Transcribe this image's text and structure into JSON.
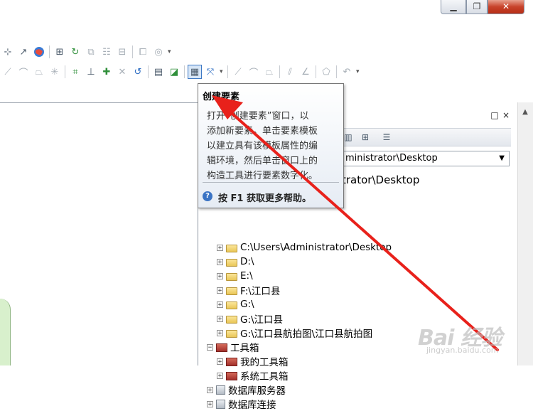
{
  "window": {
    "buttons": {
      "minimize": "▁",
      "maximize": "❐",
      "close": "✕"
    }
  },
  "tooltip": {
    "title": "创建要素",
    "body": "打开“创建要素”窗口，以添加新要素。单击要素模板以建立具有该模板属性的编辑环境，然后单击窗口上的构造工具进行要素数字化。",
    "body_lines": [
      "打开“创建要素”窗口，以",
      "添加新要素。单击要素模板",
      "以建立具有该模板属性的编",
      "辑环境，然后单击窗口上的",
      "构造工具进行要素数字化。"
    ],
    "help": "按 F1 获取更多帮助。",
    "help_icon": "?"
  },
  "catalog": {
    "path_value": "C:\\Users\\Administrator\\Desktop",
    "path_visible": "ministrator\\Desktop",
    "home_partial": "trator\\Desktop",
    "tree": [
      {
        "label": "C:\\Users\\Administrator\\Desktop",
        "icon": "folder",
        "expander": "+"
      },
      {
        "label": "D:\\",
        "icon": "folder",
        "expander": "+"
      },
      {
        "label": "E:\\",
        "icon": "folder",
        "expander": "+"
      },
      {
        "label": "F:\\江口县",
        "icon": "folder",
        "expander": "+"
      },
      {
        "label": "G:\\",
        "icon": "folder",
        "expander": "+"
      },
      {
        "label": "G:\\江口县",
        "icon": "folder",
        "expander": "+"
      },
      {
        "label": "G:\\江口县航拍图\\江口县航拍图",
        "icon": "folder",
        "expander": "+"
      },
      {
        "label": "工具箱",
        "icon": "toolbox",
        "expander": "−"
      },
      {
        "label": "我的工具箱",
        "icon": "toolbox",
        "expander": "+"
      },
      {
        "label": "系统工具箱",
        "icon": "toolbox",
        "expander": "+"
      },
      {
        "label": "数据库服务器",
        "icon": "server",
        "expander": "+"
      },
      {
        "label": "数据库连接",
        "icon": "server",
        "expander": "+"
      }
    ],
    "panel_buttons": {
      "float": "□",
      "close": "×"
    }
  },
  "watermark": {
    "brand": "Bai 经验",
    "url": "jingyan.baidu.com"
  },
  "colors": {
    "arrow": "#e8211b",
    "accent": "#3d78c4"
  }
}
